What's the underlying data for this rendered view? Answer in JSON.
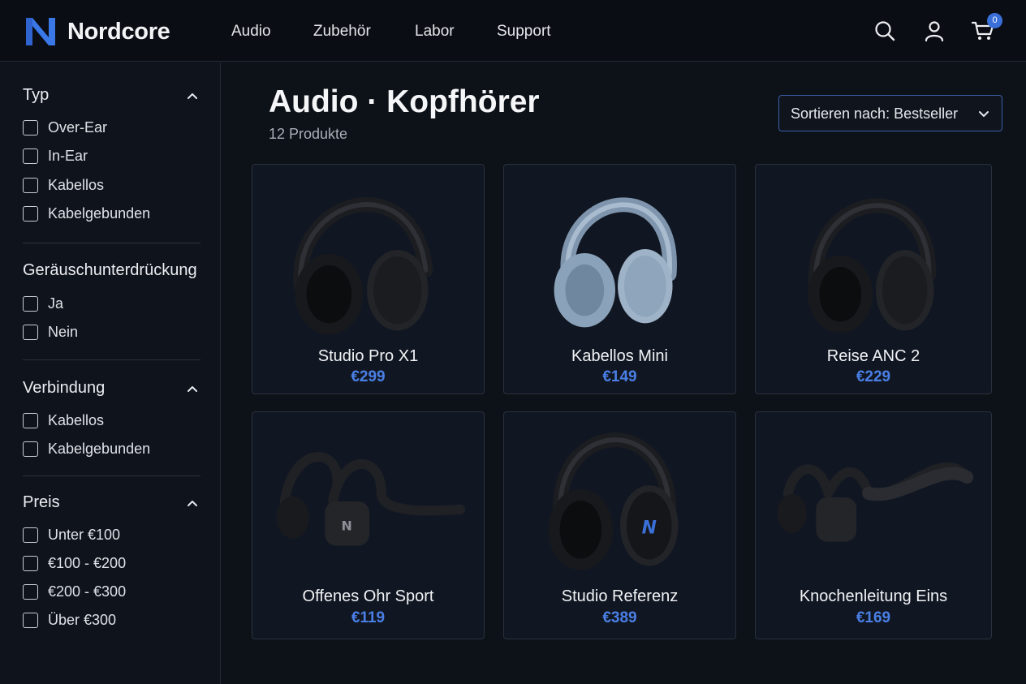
{
  "brand": {
    "name": "Nordcore",
    "logo_letter": "N",
    "accent": "#3a6fd8"
  },
  "nav": {
    "items": [
      "Audio",
      "Zubehör",
      "Labor",
      "Support"
    ]
  },
  "header_icons": [
    "search-icon",
    "user-icon",
    "cart-icon"
  ],
  "cart": {
    "count": "0"
  },
  "filters": [
    {
      "title": "Typ",
      "options": [
        "Over-Ear",
        "In-Ear",
        "Kabellos",
        "Kabelgebunden"
      ]
    },
    {
      "title": "Geräuschunterdrückung",
      "options": [
        "Ja",
        "Nein"
      ]
    },
    {
      "title": "Verbindung",
      "options": [
        "Kabellos",
        "Kabelgebunden"
      ]
    },
    {
      "title": "Preis",
      "options": [
        "Unter €100",
        "€100 - €200",
        "€200 - €300",
        "Über €300"
      ]
    }
  ],
  "main": {
    "title": "Audio · Kopfhörer",
    "count": "12 Produkte",
    "sort": {
      "label": "Sortieren nach: Bestseller"
    }
  },
  "products": [
    {
      "name": "Studio Pro X1",
      "price": "€299",
      "image": "over-ear-black-headphones"
    },
    {
      "name": "Kabellos Mini",
      "price": "€149",
      "image": "over-ear-blue-headphones"
    },
    {
      "name": "Reise ANC 2",
      "price": "€229",
      "image": "over-ear-black-headphones"
    },
    {
      "name": "Offenes Ohr Sport",
      "price": "€119",
      "image": "open-ear-sport-headphones"
    },
    {
      "name": "Studio Referenz",
      "price": "€389",
      "image": "studio-headphones"
    },
    {
      "name": "Knochenleitung Eins",
      "price": "€169",
      "image": "bone-conduction-headphones"
    }
  ]
}
